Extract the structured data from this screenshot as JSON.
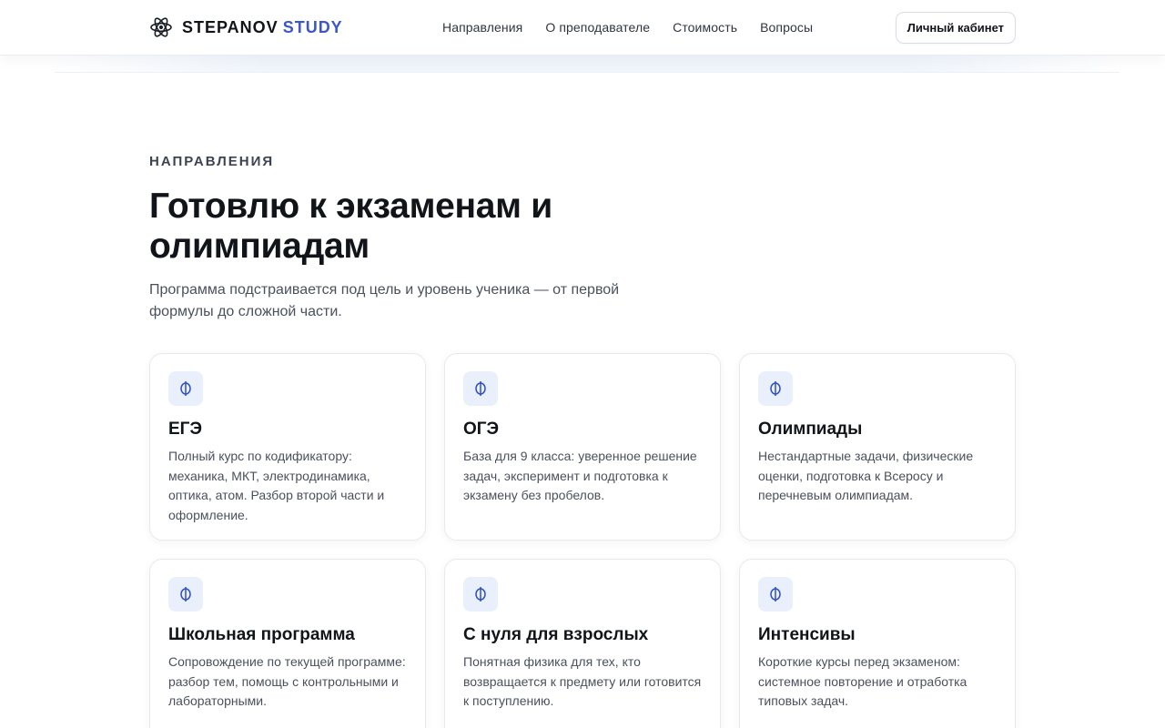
{
  "header": {
    "logo": {
      "part1": "STEPANOV",
      "part2": "STUDY",
      "icon": "atom-icon"
    },
    "nav": [
      "Направления",
      "О преподавателе",
      "Стоимость",
      "Вопросы"
    ],
    "account_button": "Личный кабинет"
  },
  "section": {
    "eyebrow": "НАПРАВЛЕНИЯ",
    "title": "Готовлю к экзаменам и олимпиадам",
    "subtitle": "Программа подстраивается под цель и уровень ученика — от первой формулы до сложной части."
  },
  "cards": [
    {
      "title": "ЕГЭ",
      "text": "Полный курс по кодификатору: механика, МКТ, электродинамика, оптика, атом. Разбор второй части и оформление.",
      "icon": "phi-icon"
    },
    {
      "title": "ОГЭ",
      "text": "База для 9 класса: уверенное решение задач, эксперимент и подготовка к экзамену без пробелов.",
      "icon": "phi-icon"
    },
    {
      "title": "Олимпиады",
      "text": "Нестандартные задачи, физические оценки, подготовка к Всеросу и перечневым олимпиадам.",
      "icon": "phi-icon"
    },
    {
      "title": "Школьная программа",
      "text": "Сопровождение по текущей программе: разбор тем, помощь с контрольными и лабораторными.",
      "icon": "phi-icon"
    },
    {
      "title": "С нуля для взрослых",
      "text": "Понятная физика для тех, кто возвращается к предмету или готовится к поступлению.",
      "icon": "phi-icon"
    },
    {
      "title": "Интенсивы",
      "text": "Короткие курсы перед экзаменом: системное повторение и отработка типовых задач.",
      "icon": "phi-icon"
    }
  ],
  "colors": {
    "accent": "#3b57c9",
    "icon_bg": "#eaf0fb",
    "text": "#111418",
    "muted": "#4a515c"
  }
}
